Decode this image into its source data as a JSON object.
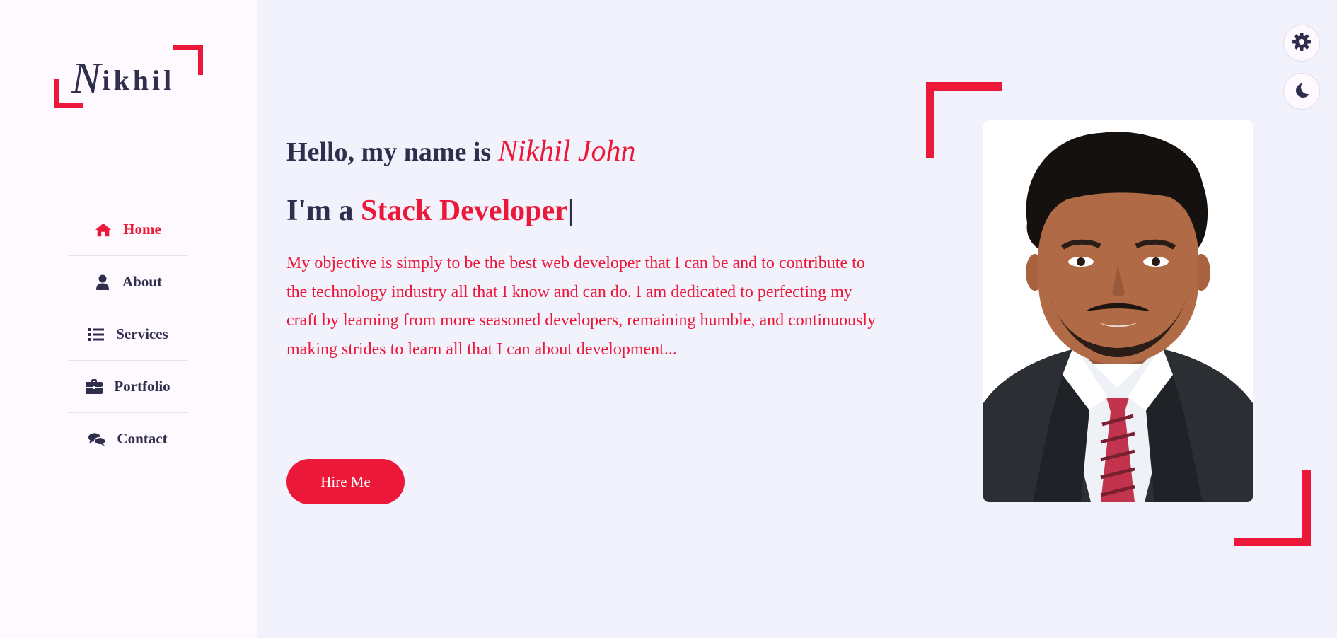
{
  "logo": {
    "initial": "N",
    "rest": "ikhil"
  },
  "nav": {
    "items": [
      {
        "label": "Home",
        "icon": "home-icon",
        "active": true
      },
      {
        "label": "About",
        "icon": "user-icon",
        "active": false
      },
      {
        "label": "Services",
        "icon": "list-icon",
        "active": false
      },
      {
        "label": "Portfolio",
        "icon": "briefcase-icon",
        "active": false
      },
      {
        "label": "Contact",
        "icon": "comments-icon",
        "active": false
      }
    ]
  },
  "hero": {
    "greeting": "Hello, my name is ",
    "name": "Nikhil John",
    "role_prefix": "I'm a ",
    "role_accent": "Stack Developer",
    "caret": "|",
    "bio": "My objective is simply to be the best web developer that I can be and to contribute to the technology industry all that I know and can do. I am dedicated to perfecting my craft by learning from more seasoned developers, remaining humble, and continuously making strides to learn all that I can about development...",
    "button_label": "Hire Me"
  },
  "controls": {
    "settings_icon": "gear-icon",
    "theme_icon": "moon-icon"
  },
  "colors": {
    "accent": "#ec1839",
    "text_dark": "#302e4d",
    "bg_main": "#f2f2fc",
    "bg_sidebar": "#fdf9ff"
  }
}
